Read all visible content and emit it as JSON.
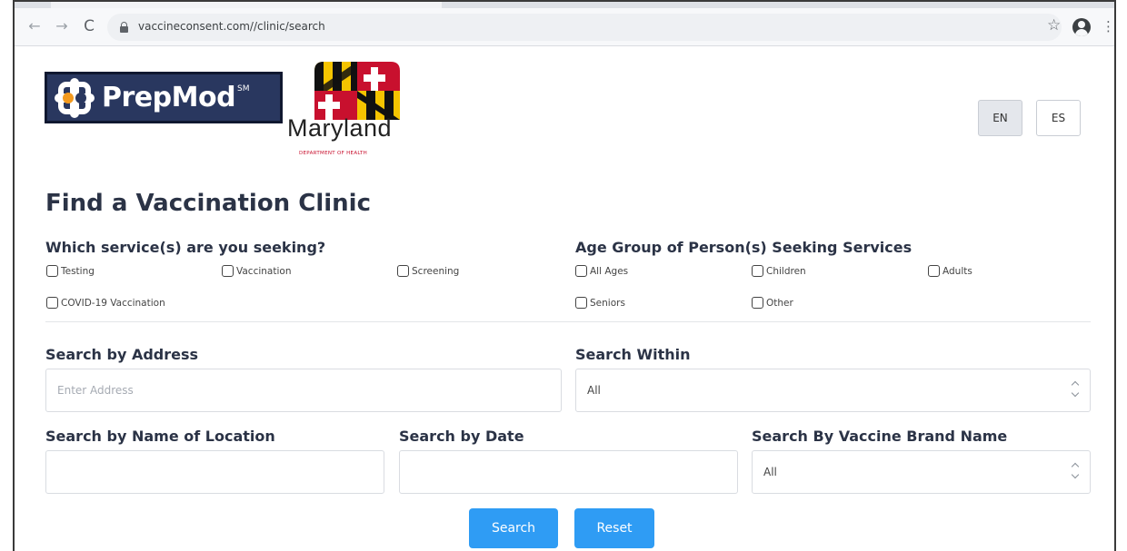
{
  "browser": {
    "url": "vaccineconsent.com//clinic/search",
    "back_icon": "back-arrow-icon",
    "forward_icon": "forward-arrow-icon",
    "reload_icon": "reload-icon",
    "star_glyph": "☆",
    "menu_glyph": "⋮"
  },
  "logos": {
    "prepmod_name": "PrepMod",
    "prepmod_mark": "SM",
    "maryland_name": "Maryland",
    "maryland_sub": "DEPARTMENT OF HEALTH",
    "colors": {
      "prepmod_navy": "#29375f",
      "prepmod_orange": "#f39a1e",
      "md_red": "#c8102e",
      "md_gold": "#f5c400"
    }
  },
  "language": {
    "en": "EN",
    "es": "ES",
    "selected": "EN"
  },
  "form": {
    "title": "Find a Vaccination Clinic",
    "services": {
      "label": "Which service(s) are you seeking?",
      "options": [
        "Testing",
        "Vaccination",
        "Screening",
        "COVID-19 Vaccination"
      ]
    },
    "age_group": {
      "label": "Age Group of Person(s) Seeking Services",
      "options": [
        "All Ages",
        "Children",
        "Adults",
        "Seniors",
        "Other"
      ]
    },
    "address": {
      "label": "Search by Address",
      "placeholder": "Enter Address",
      "value": ""
    },
    "within": {
      "label": "Search Within",
      "value": "All"
    },
    "location_name": {
      "label": "Search by Name of Location",
      "value": ""
    },
    "date": {
      "label": "Search by Date",
      "value": ""
    },
    "brand": {
      "label": "Search By Vaccine Brand Name",
      "value": "All"
    },
    "buttons": {
      "search": "Search",
      "reset": "Reset"
    },
    "accent_color": "#2f9cf4"
  }
}
